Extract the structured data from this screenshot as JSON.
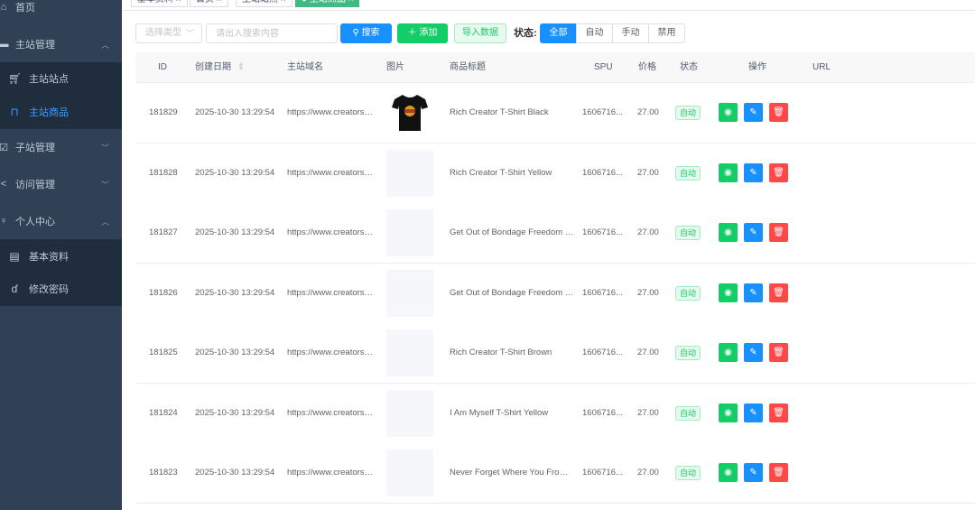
{
  "sidebar": {
    "items": [
      {
        "label": "首页",
        "icon": "home-icon"
      },
      {
        "label": "主站管理",
        "icon": "clipboard-icon",
        "expanded": true,
        "children": [
          {
            "label": "主站站点",
            "icon": "cart-icon"
          },
          {
            "label": "主站商品",
            "icon": "bag-icon",
            "active": true
          }
        ]
      },
      {
        "label": "子站管理",
        "icon": "checkbox-icon",
        "expanded": false
      },
      {
        "label": "访问管理",
        "icon": "share-icon",
        "expanded": false
      },
      {
        "label": "个人中心",
        "icon": "user-icon",
        "expanded": true,
        "children": [
          {
            "label": "基本资料",
            "icon": "document-icon"
          },
          {
            "label": "修改密码",
            "icon": "key-icon"
          }
        ]
      }
    ]
  },
  "tags": [
    {
      "label": "基本资料 ×",
      "active": false
    },
    {
      "label": "首页 ×",
      "active": false
    },
    {
      "label": "主站站点 ×",
      "active": false
    },
    {
      "label": "● 主站商品 ×",
      "active": true
    }
  ],
  "toolbar": {
    "type_placeholder": "选择类型",
    "search_placeholder": "请出入搜索内容",
    "search_label": "搜索",
    "add_label": "添加",
    "import_label": "导入数据",
    "status_label": "状态:",
    "status_options": [
      "全部",
      "自动",
      "手动",
      "禁用"
    ],
    "status_selected": "全部"
  },
  "table": {
    "headers": {
      "id": "ID",
      "created": "创建日期",
      "domain": "主站域名",
      "image": "图片",
      "title": "商品标题",
      "spu": "SPU",
      "price": "价格",
      "status": "状态",
      "actions": "操作",
      "url": "URL"
    },
    "rows": [
      {
        "id": "181829",
        "created": "2025-10-30 13:29:54",
        "domain": "https://www.creatorshi...",
        "has_image": true,
        "title": "Rich Creator T-Shirt Black",
        "spu": "1606716...",
        "price": "27.00",
        "status": "自动"
      },
      {
        "id": "181828",
        "created": "2025-10-30 13:29:54",
        "domain": "https://www.creatorshi...",
        "has_image": false,
        "title": "Rich Creator T-Shirt Yellow",
        "spu": "1606716...",
        "price": "27.00",
        "status": "自动"
      },
      {
        "id": "181827",
        "created": "2025-10-30 13:29:54",
        "domain": "https://www.creatorshi...",
        "has_image": false,
        "title": "Get Out of Bondage Freedom T...",
        "spu": "1606716...",
        "price": "27.00",
        "status": "自动"
      },
      {
        "id": "181826",
        "created": "2025-10-30 13:29:54",
        "domain": "https://www.creatorshi...",
        "has_image": false,
        "title": "Get Out of Bondage Freedom T...",
        "spu": "1606716...",
        "price": "27.00",
        "status": "自动"
      },
      {
        "id": "181825",
        "created": "2025-10-30 13:29:54",
        "domain": "https://www.creatorshi...",
        "has_image": false,
        "title": "Rich Creator T-Shirt Brown",
        "spu": "1606716...",
        "price": "27.00",
        "status": "自动"
      },
      {
        "id": "181824",
        "created": "2025-10-30 13:29:54",
        "domain": "https://www.creatorshi...",
        "has_image": false,
        "title": "I Am Myself T-Shirt Yellow",
        "spu": "1606716...",
        "price": "27.00",
        "status": "自动"
      },
      {
        "id": "181823",
        "created": "2025-10-30 13:29:54",
        "domain": "https://www.creatorshi...",
        "has_image": false,
        "title": "Never Forget Where You From ...",
        "spu": "1606716...",
        "price": "27.00",
        "status": "自动"
      }
    ]
  },
  "colors": {
    "sidebar_bg": "#304156",
    "submenu_bg": "#1f2d3d",
    "primary": "#1890ff",
    "success": "#13ce66",
    "danger": "#ff4949"
  }
}
